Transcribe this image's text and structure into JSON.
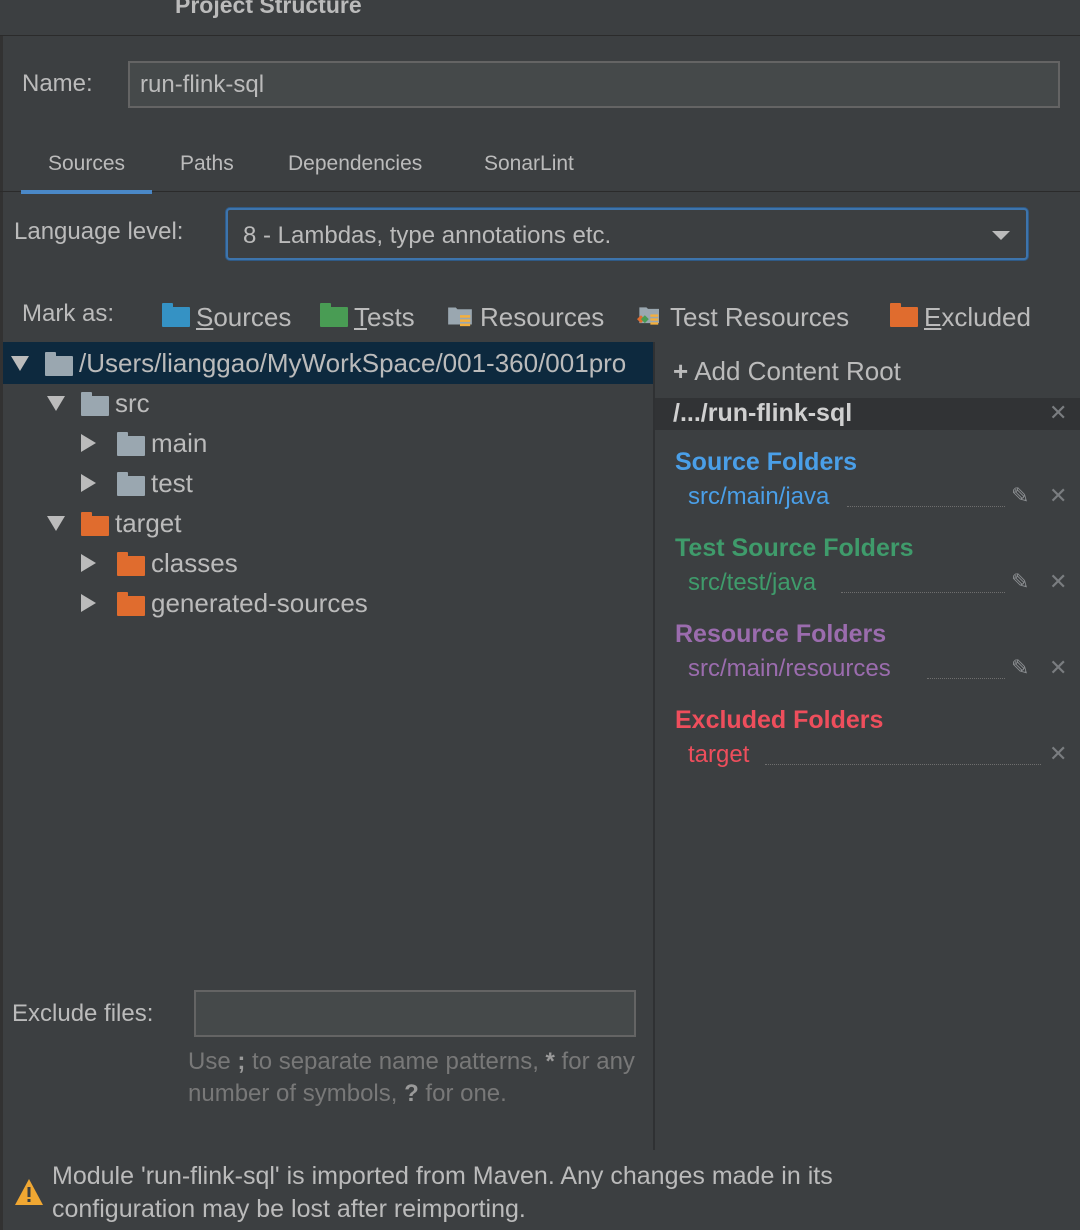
{
  "window": {
    "title": "Project Structure"
  },
  "name_field": {
    "label": "Name:",
    "value": "run-flink-sql"
  },
  "tabs": [
    {
      "label": "Sources",
      "active": true
    },
    {
      "label": "Paths",
      "active": false
    },
    {
      "label": "Dependencies",
      "active": false
    },
    {
      "label": "SonarLint",
      "active": false
    }
  ],
  "language_level": {
    "label": "Language level:",
    "value": "8 - Lambdas, type annotations etc."
  },
  "mark_as": {
    "label": "Mark as:",
    "items": [
      {
        "label": "Sources",
        "mnemonic": "S",
        "color": "#3592c4"
      },
      {
        "label": "Tests",
        "mnemonic": "T",
        "color": "#499c54"
      },
      {
        "label": "Resources",
        "color": "#9aa7b0"
      },
      {
        "label": "Test Resources",
        "color": "#9aa7b0"
      },
      {
        "label": "Excluded",
        "mnemonic": "E",
        "color": "#e06c2e"
      }
    ]
  },
  "tree": {
    "root": "/Users/lianggao/MyWorkSpace/001-360/001pro",
    "src": "src",
    "main": "main",
    "test": "test",
    "target": "target",
    "classes": "classes",
    "generated_sources": "generated-sources"
  },
  "content_root": {
    "add_label": "Add Content Root",
    "root_path": "/.../run-flink-sql",
    "sections": [
      {
        "title": "Source Folders",
        "path": "src/main/java",
        "color": "#4a9fe8"
      },
      {
        "title": "Test Source Folders",
        "path": "src/test/java",
        "color": "#3f9b6b"
      },
      {
        "title": "Resource Folders",
        "path": "src/main/resources",
        "color": "#9b6cae"
      },
      {
        "title": "Excluded Folders",
        "path": "target",
        "color": "#ee4e5c"
      }
    ]
  },
  "exclude_files": {
    "label": "Exclude files:",
    "value": "",
    "hint_1": "Use ",
    "hint_semicolon": ";",
    "hint_2": " to separate name patterns, ",
    "hint_star": "*",
    "hint_3": " for any number of symbols, ",
    "hint_q": "?",
    "hint_4": " for one."
  },
  "warning": {
    "line1": "Module 'run-flink-sql' is imported from Maven. Any changes made in its",
    "line2": "configuration may be lost after reimporting."
  },
  "colors": {
    "background": "#3c3f41",
    "selection": "#0d293e",
    "accent": "#4a88c7",
    "folder_gray": "#9aa7b0",
    "folder_excluded": "#e06c2e"
  }
}
